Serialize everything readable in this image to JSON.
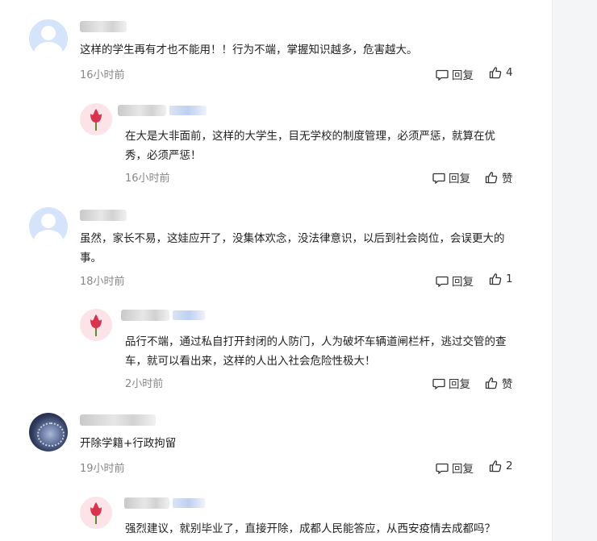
{
  "comments": [
    {
      "text": "这样的学生再有才也不能用！！行为不端，掌握知识越多，危害越大。",
      "time": "16小时前",
      "reply_label": "回复",
      "like_label": "4",
      "replies": [
        {
          "text": "在大是大非面前，这样的大学生，目无学校的制度管理，必须严惩，就算在优秀，必须严惩！",
          "time": "16小时前",
          "reply_label": "回复",
          "like_label": "赞"
        }
      ]
    },
    {
      "text": "虽然，家长不易，这娃应开了，没集体欢念，没法律意识，以后到社会岗位，会误更大的事。",
      "time": "18小时前",
      "reply_label": "回复",
      "like_label": "1",
      "replies": [
        {
          "text": "品行不端，通过私自打开封闭的人防门，人为破坏车辆道闸栏杆，逃过交管的查车，就可以看出来，这样的人出入社会危险性极大！",
          "time": "2小时前",
          "reply_label": "回复",
          "like_label": "赞"
        }
      ]
    },
    {
      "text": "开除学籍+行政拘留",
      "time": "19小时前",
      "reply_label": "回复",
      "like_label": "2",
      "replies": [
        {
          "text": "强烈建议，就别毕业了，直接开除，成都人民能答应，从西安疫情去成都吗？"
        }
      ]
    }
  ],
  "icons": {
    "reply": "comment-bubble-icon",
    "like": "thumbs-up-icon",
    "avatar_default": "default-user-avatar",
    "avatar_tulip": "tulip-avatar",
    "avatar_space": "abstract-sphere-avatar"
  }
}
